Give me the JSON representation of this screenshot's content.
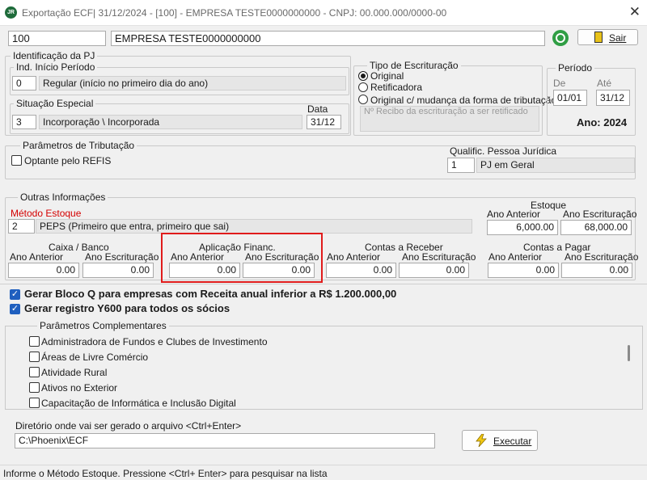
{
  "window": {
    "title": "Exportação ECF| 31/12/2024 - [100] - EMPRESA TESTE0000000000 - CNPJ: 00.000.000/0000-00",
    "app_icon_text": "JR",
    "close_glyph": "✕"
  },
  "header": {
    "company_code": "100",
    "company_name": "EMPRESA TESTE0000000000",
    "exit_label": "Sair"
  },
  "identificacao": {
    "group_title": "Identificação da PJ",
    "inicio_periodo": {
      "title": "Ind. Início Período",
      "code": "0",
      "description": "Regular (início no primeiro dia do ano)"
    },
    "situacao_especial": {
      "title": "Situação Especial",
      "code": "3",
      "description": "Incorporação \\ Incorporada",
      "data_label": "Data",
      "data_value": "31/12"
    }
  },
  "tipo_escrituracao": {
    "title": "Tipo de Escrituração",
    "options": [
      "Original",
      "Retificadora",
      "Original c/ mudança da forma de tributação"
    ],
    "selected": "Original",
    "recibo_placeholder": "Nº Recibo da escrituração a ser retificado"
  },
  "periodo": {
    "title": "Período",
    "de_label": "De",
    "ate_label": "Até",
    "de_value": "01/01",
    "ate_value": "31/12",
    "ano_label": "Ano: 2024"
  },
  "tributacao": {
    "title": "Parâmetros de Tributação",
    "refis_label": "Optante pelo REFIS",
    "refis_checked": false,
    "qualific_label": "Qualific. Pessoa Jurídica",
    "qualific_code": "1",
    "qualific_desc": "PJ em Geral"
  },
  "outras": {
    "title": "Outras Informações",
    "metodo_label": "Método Estoque",
    "metodo_code": "2",
    "metodo_desc": "PEPS (Primeiro que entra, primeiro que sai)",
    "estoque": {
      "title": "Estoque",
      "ano_anterior_label": "Ano Anterior",
      "ano_escrituracao_label": "Ano Escrituração",
      "ano_anterior": "6,000.00",
      "ano_escrituracao": "68,000.00"
    },
    "caixa": {
      "title": "Caixa / Banco",
      "ano_anterior_label": "Ano  Anterior",
      "ano_escrituracao_label": "Ano Escrituração",
      "ano_anterior": "0.00",
      "ano_escrituracao": "0.00"
    },
    "aplicacao": {
      "title": "Aplicação Financ.",
      "ano_anterior_label": "Ano  Anterior",
      "ano_escrituracao_label": "Ano Escrituração",
      "ano_anterior": "0.00",
      "ano_escrituracao": "0.00"
    },
    "receber": {
      "title": "Contas a Receber",
      "ano_anterior_label": "Ano Anterior",
      "ano_escrituracao_label": "Ano Escrituração",
      "ano_anterior": "0.00",
      "ano_escrituracao": "0.00"
    },
    "pagar": {
      "title": "Contas a Pagar",
      "ano_anterior_label": "Ano Anterior",
      "ano_escrituracao_label": "Ano Escrituração",
      "ano_anterior": "0.00",
      "ano_escrituracao": "0.00"
    }
  },
  "opcoes": {
    "bloco_q_label": "Gerar Bloco Q para empresas com Receita anual inferior a R$ 1.200.000,00",
    "bloco_q_checked": true,
    "y600_label": "Gerar registro Y600 para todos os sócios",
    "y600_checked": true
  },
  "complementares": {
    "title": "Parâmetros Complementares",
    "items": [
      "Administradora de Fundos e Clubes de Investimento",
      "Áreas de Livre Comércio",
      "Atividade Rural",
      "Ativos no Exterior",
      "Capacitação de Informática e Inclusão Digital"
    ]
  },
  "diretorio": {
    "label": "Diretório onde vai ser gerado o arquivo <Ctrl+Enter>",
    "value": "C:\\Phoenix\\ECF",
    "executar_label": "Executar"
  },
  "status": {
    "text": "Informe o Método Estoque. Pressione <Ctrl+ Enter> para pesquisar na lista"
  },
  "colors": {
    "highlight_border": "#e01b1b",
    "checkbox_checked": "#1f5fbf",
    "metodo_label": "#d40000"
  }
}
